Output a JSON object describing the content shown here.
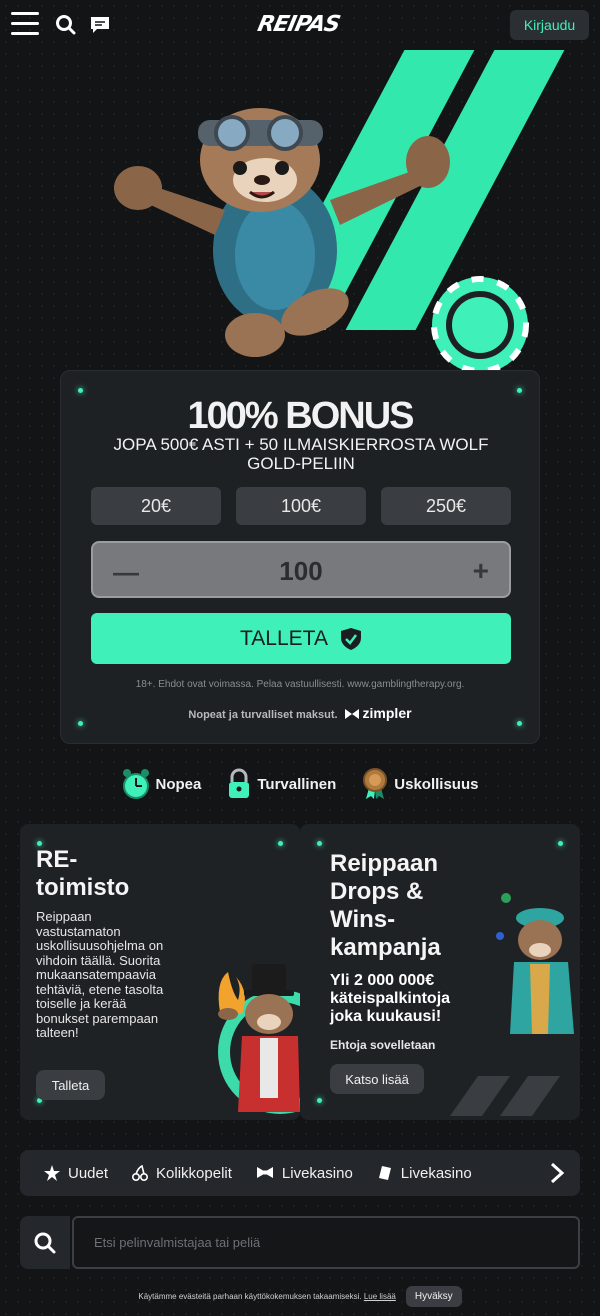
{
  "header": {
    "logo": "REIPAS",
    "login_label": "Kirjaudu"
  },
  "bonus": {
    "title": "100% BONUS",
    "subtitle": "JOPA 500€ ASTI + 50 ILMAISKIERROSTA WOLF GOLD-PELIIN",
    "amounts": [
      "20€",
      "100€",
      "250€"
    ],
    "stepper_value": "100",
    "deposit_label": "TALLETA",
    "terms": "18+. Ehdot ovat voimassa. Pelaa vastuullisesti. www.gamblingtherapy.org.",
    "payments_text": "Nopeat ja turvalliset maksut.",
    "payments_brand": "zimpler"
  },
  "features": [
    {
      "label": "Nopea",
      "icon": "alarm-clock-icon"
    },
    {
      "label": "Turvallinen",
      "icon": "padlock-icon"
    },
    {
      "label": "Uskollisuus",
      "icon": "medal-icon"
    }
  ],
  "promos": [
    {
      "title": "RE-toimisto",
      "title_line1": "RE-",
      "title_line2": "toimisto",
      "description": "Reippaan vastustamaton uskollisuusohjelma on vihdoin täällä. Suorita mukaansatempaavia tehtäviä, etene tasolta toiselle ja kerää bonukset parempaan talteen!",
      "button": "Talleta"
    },
    {
      "title": "Reippaan Drops & Wins-kampanja",
      "title_lines": [
        "Reippaan",
        "Drops &",
        "Wins-",
        "kampanja"
      ],
      "highlight_lines": [
        "Yli 2 000 000€",
        "käteispalkintoja",
        "joka kuukausi!"
      ],
      "terms": "Ehtoja sovelletaan",
      "button": "Katso lisää"
    }
  ],
  "nav": [
    {
      "label": "Uudet",
      "icon": "star-icon"
    },
    {
      "label": "Kolikkopelit",
      "icon": "cherries-icon"
    },
    {
      "label": "Livekasino",
      "icon": "bowtie-icon"
    },
    {
      "label": "Livekasino",
      "icon": "card-icon"
    }
  ],
  "search": {
    "placeholder": "Etsi pelinvalmistajaa tai peliä"
  },
  "cookie": {
    "text": "Käytämme evästeitä parhaan käyttökokemuksen takaamiseksi.",
    "link": "Lue lisää",
    "accept": "Hyväksy"
  },
  "colors": {
    "accent": "#3ff0b8",
    "background": "#121416",
    "card": "#1e2124"
  }
}
